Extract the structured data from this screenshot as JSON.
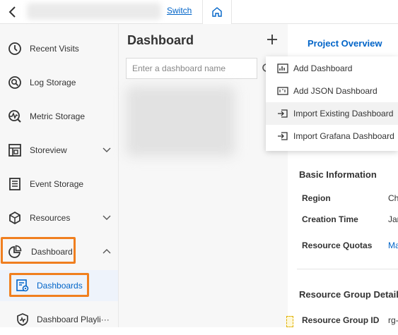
{
  "topbar": {
    "switch_label": "Switch"
  },
  "sidebar": {
    "items": [
      {
        "label": "Recent Visits"
      },
      {
        "label": "Log Storage"
      },
      {
        "label": "Metric Storage"
      },
      {
        "label": "Storeview"
      },
      {
        "label": "Event Storage"
      },
      {
        "label": "Resources"
      },
      {
        "label": "Dashboard"
      }
    ],
    "sub_items": [
      {
        "label": "Dashboards"
      },
      {
        "label": "Dashboard Playli···"
      }
    ]
  },
  "dashboard_panel": {
    "title": "Dashboard",
    "search_placeholder": "Enter a dashboard name"
  },
  "dropdown": {
    "items": [
      {
        "label": "Add Dashboard"
      },
      {
        "label": "Add JSON Dashboard"
      },
      {
        "label": "Import Existing Dashboard"
      },
      {
        "label": "Import Grafana Dashboard"
      }
    ]
  },
  "details": {
    "project_overview": "Project Overview",
    "basic_info_title": "Basic Information",
    "region_key": "Region",
    "region_val": "Ch",
    "creation_key": "Creation Time",
    "creation_val": "Jar",
    "quotas_key": "Resource Quotas",
    "quotas_val": "Ma",
    "rg_title": "Resource Group Detail",
    "rg_id_key": "Resource Group ID",
    "rg_id_val": "rg-"
  },
  "colors": {
    "accent": "#0064c8",
    "highlight": "#f07f1f"
  }
}
